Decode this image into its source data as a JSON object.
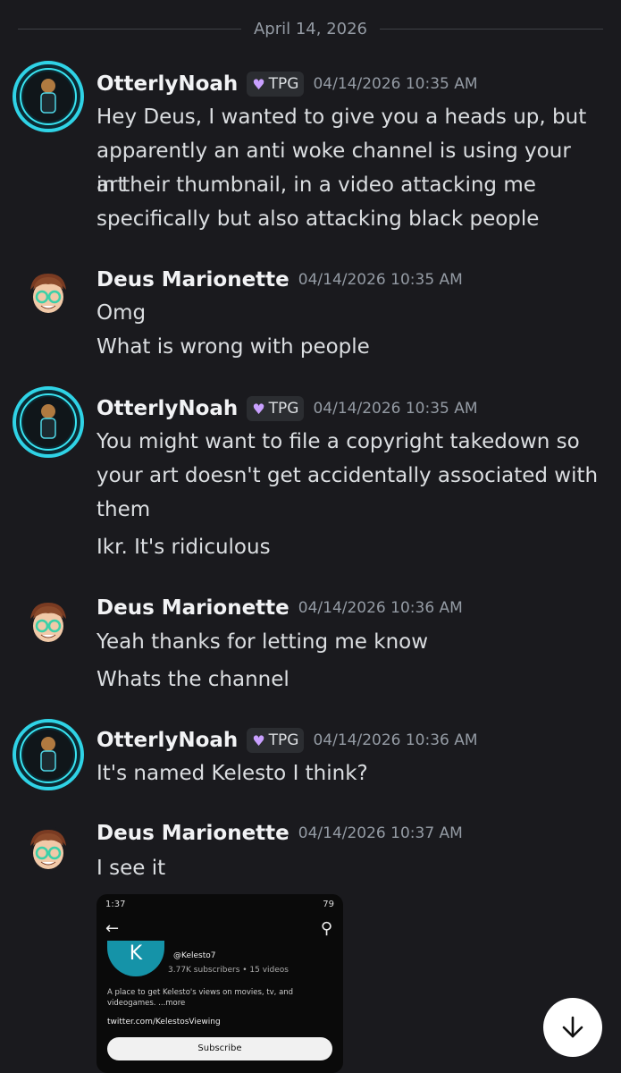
{
  "date_divider": "April 14, 2026",
  "tag_label": "TPG",
  "messages": [
    {
      "author": "OtterlyNoah",
      "time": "04/14/2026 10:35 AM",
      "lines": [
        "Hey Deus, I wanted to give you a heads up, but",
        "apparently an anti woke channel is using your art",
        "in their thumbnail, in a video attacking me",
        "specifically but also attacking black people"
      ]
    },
    {
      "author": "Deus Marionette",
      "time": "04/14/2026 10:35 AM",
      "lines": [
        "Omg",
        "What is wrong with people"
      ]
    },
    {
      "author": "OtterlyNoah",
      "time": "04/14/2026 10:35 AM",
      "lines": [
        "You might want to file a copyright takedown so",
        "your art doesn't get accidentally associated with",
        "them",
        "Ikr. It's ridiculous"
      ]
    },
    {
      "author": "Deus Marionette",
      "time": "04/14/2026 10:36 AM",
      "lines": [
        "Yeah  thanks for letting me know",
        "Whats the channel"
      ]
    },
    {
      "author": "OtterlyNoah",
      "time": "04/14/2026 10:36 AM",
      "lines": [
        "It's named Kelesto I think?"
      ]
    },
    {
      "author": "Deus Marionette",
      "time": "04/14/2026 10:37 AM",
      "lines": [
        "I see it"
      ]
    }
  ],
  "attachment": {
    "status_time": "1:37",
    "status_right": "79",
    "logo_letter": "K",
    "handle": "@Kelesto7",
    "subscribers": "3.77K subscribers • 15 videos",
    "description": "A place to get Kelesto's views on movies, tv, and videogames. ...more",
    "link": "twitter.com/KelestosViewing",
    "subscribe_label": "Subscribe"
  },
  "icons": {
    "scroll_down": "arrow-down-icon",
    "tag_badge": "heart-icon"
  },
  "colors": {
    "background": "#1a1a1e",
    "username": "#f2f3f5",
    "timestamp": "#949ba4",
    "tag_heart": "#c9a0ff"
  }
}
